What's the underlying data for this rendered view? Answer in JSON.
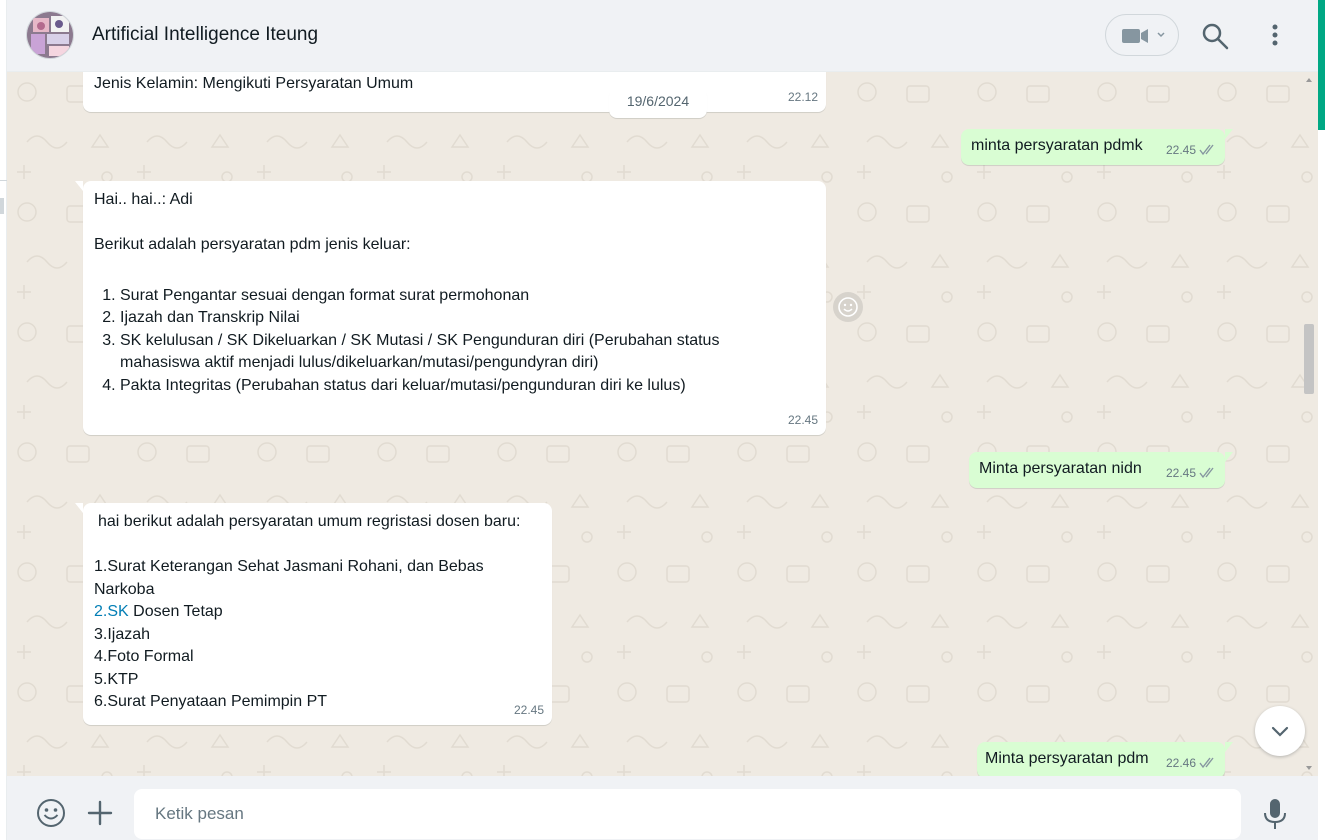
{
  "header": {
    "title": "Artificial Intelligence Iteung",
    "avatar_icon": "group-avatar",
    "icons": [
      "video-call-icon",
      "search-icon",
      "menu-icon"
    ]
  },
  "messages": {
    "m1": {
      "text": "Jenis Kelamin: Mengikuti Persyaratan Umum",
      "time": "22.12"
    },
    "date_chip": "19/6/2024",
    "m2": {
      "text": "minta persyaratan pdmk",
      "time": "22.45"
    },
    "m3": {
      "greeting": "Hai.. hai..: Adi",
      "intro": "Berikut adalah persyaratan pdm jenis keluar:",
      "items": [
        "Surat Pengantar sesuai dengan format surat permohonan",
        "Ijazah dan Transkrip Nilai",
        "SK kelulusan / SK Dikeluarkan / SK Mutasi / SK Pengunduran diri (Perubahan status mahasiswa aktif menjadi lulus/dikeluarkan/mutasi/pengundyran diri)",
        "Pakta Integritas (Perubahan status dari keluar/mutasi/pengunduran diri ke lulus)"
      ],
      "time": "22.45"
    },
    "m4": {
      "text": "Minta persyaratan nidn",
      "time": "22.45"
    },
    "m5": {
      "intro": "hai berikut adalah persyaratan umum regristasi dosen baru:",
      "line1": "1.Surat Keterangan Sehat Jasmani Rohani, dan Bebas Narkoba",
      "line2_link": "2.SK",
      "line2_rest": " Dosen Tetap",
      "line3": "3.Ijazah",
      "line4": "4.Foto Formal",
      "line5": "5.KTP",
      "line6": "6.Surat Penyataan Pemimpin PT",
      "time": "22.45"
    },
    "m6": {
      "text": "Minta persyaratan pdm",
      "time": "22.46"
    }
  },
  "footer": {
    "input_placeholder": "Ketik pesan",
    "icons": [
      "emoji-icon",
      "plus-icon",
      "mic-icon"
    ]
  },
  "colors": {
    "outgoing_bubble": "#d9fdd3",
    "incoming_bubble": "#ffffff",
    "chat_bg": "#efeae2",
    "accent": "#00a884",
    "read_ticks": "#53bdeb",
    "link": "#027eb5"
  }
}
